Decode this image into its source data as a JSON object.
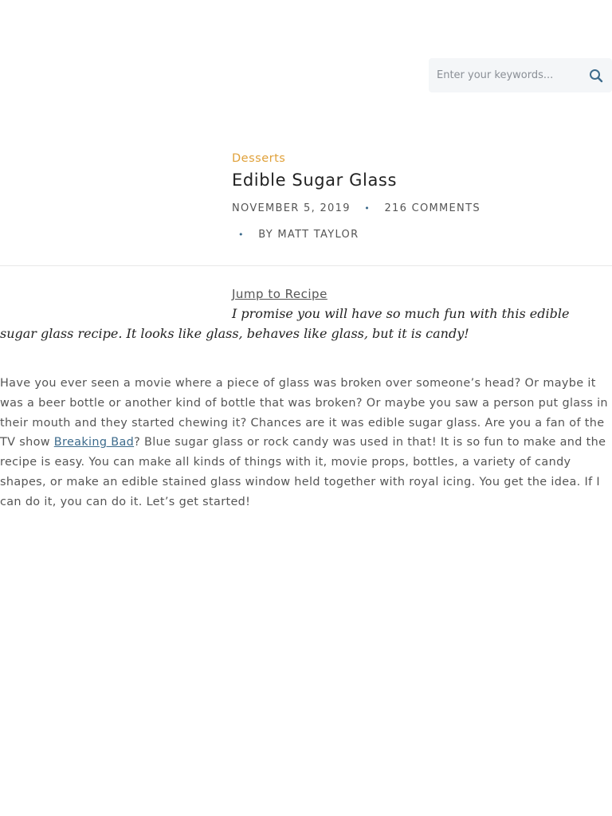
{
  "search": {
    "placeholder": "Enter your keywords..."
  },
  "post": {
    "category": "Desserts",
    "title": "Edible Sugar Glass",
    "date": "November 5, 2019",
    "comments": "216 Comments",
    "author": "By Matt Taylor",
    "jump_label": "Jump to Recipe",
    "intro": "I promise you will have so much fun with this edible sugar glass recipe. It looks like glass, behaves like glass, but it is candy!",
    "body_before_link": "Have you ever seen a movie where a piece of glass was broken over someone’s head? Or maybe it was a beer bottle or another kind of bottle that was broken? Or maybe you saw a person put glass in their mouth and they started chewing it? Chances are it was edible sugar glass. Are you a fan of the TV show ",
    "body_link": "Breaking Bad",
    "body_after_link": "? Blue sugar glass or rock candy was used in that! It is so fun to make and the recipe is easy. You can make all kinds of things with it, movie props, bottles, a variety of candy shapes, or make an edible stained glass window held together with royal icing. You get the idea. If I can do it, you can do it. Let’s get started!"
  },
  "icons": {
    "search": "search-icon",
    "separator": "•"
  },
  "colors": {
    "accent": "#e0a13a",
    "link": "#3d6b8c",
    "title": "#222222",
    "text": "#555555",
    "search_bg": "#f4f6f8"
  }
}
